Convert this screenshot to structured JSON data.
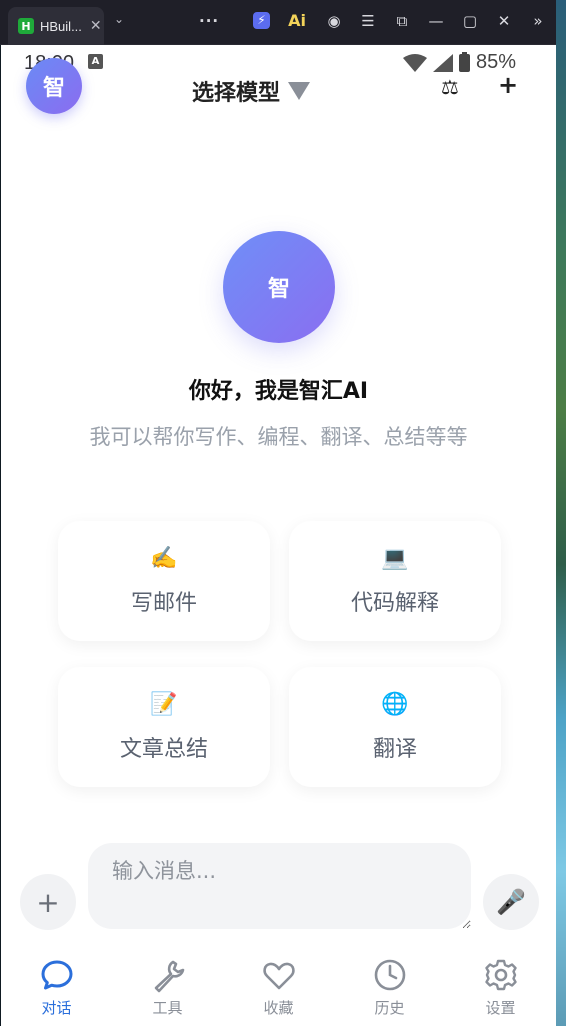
{
  "window": {
    "tab_logo": "H",
    "tab_title": "HBuil...",
    "icons": [
      "close-icon",
      "chevron-down-icon",
      "more-icon",
      "bolt-icon",
      "ai-icon",
      "account-icon",
      "menu-icon",
      "screenshot-icon",
      "minimize-icon",
      "maximize-icon",
      "close-icon",
      "expand-icon"
    ]
  },
  "status_bar": {
    "time": "18:00",
    "battery": "85%"
  },
  "header": {
    "avatar_text": "智",
    "model_select_label": "选择模型",
    "compare_icon": "scale-icon",
    "add_label": "+"
  },
  "hero": {
    "avatar_text": "智",
    "title": "你好，我是智汇AI",
    "subtitle": "我可以帮你写作、编程、翻译、总结等等"
  },
  "quick_actions": [
    {
      "icon": "✍️",
      "label": "写邮件"
    },
    {
      "icon": "💻",
      "label": "代码解释"
    },
    {
      "icon": "📝",
      "label": "文章总结"
    },
    {
      "icon": "🌐",
      "label": "翻译"
    }
  ],
  "composer": {
    "add_label": "+",
    "placeholder": "输入消息...",
    "mic_icon": "🎤"
  },
  "tabbar": [
    {
      "label": "对话",
      "icon": "chat-icon",
      "active": true
    },
    {
      "label": "工具",
      "icon": "wrench-icon",
      "active": false
    },
    {
      "label": "收藏",
      "icon": "heart-icon",
      "active": false
    },
    {
      "label": "历史",
      "icon": "clock-icon",
      "active": false
    },
    {
      "label": "设置",
      "icon": "gear-icon",
      "active": false
    }
  ],
  "colors": {
    "accent": "#2b6fdb",
    "avatar_gradient_start": "#6f8ff7",
    "avatar_gradient_end": "#8a6ef1",
    "inactive_tab": "#8a8f98"
  }
}
